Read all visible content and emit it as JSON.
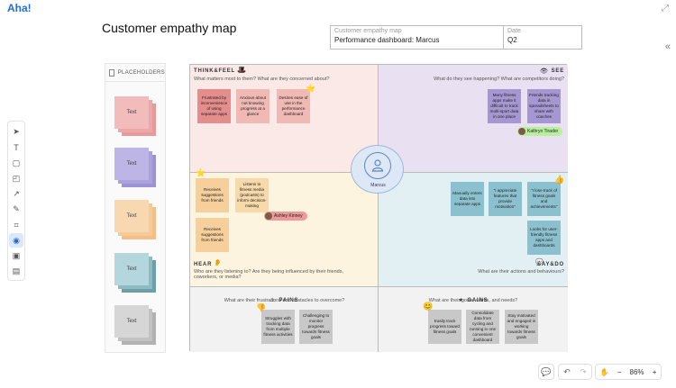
{
  "app": {
    "logo": "Aha!"
  },
  "page": {
    "title": "Customer empathy map"
  },
  "info": {
    "name_label": "Customer empathy map",
    "name_value": "Performance dashboard: Marcus",
    "date_label": "Date",
    "date_value": "Q2"
  },
  "placeholders": {
    "header": "PLACEHOLDERS",
    "items": [
      {
        "label": "Text",
        "color": "#f2b4b4"
      },
      {
        "label": "Text",
        "color": "#b4ade2"
      },
      {
        "label": "Text",
        "color": "#f6d0a5"
      },
      {
        "label": "Text",
        "color": "#a9d2d8"
      },
      {
        "label": "Text",
        "color": "#cfcfcf"
      }
    ]
  },
  "map": {
    "center_name": "Marcus",
    "think": {
      "title": "THINK&FEEL",
      "question": "What matters most to them? What are they concerned about?",
      "notes": [
        "Frustrated by inconvenience of using separate apps",
        "Anxious about not knowing progress at a glance",
        "Desires ease of use in the performance dashboard"
      ]
    },
    "see": {
      "title": "SEE",
      "question": "What do they see happening? What are competitors doing?",
      "notes": [
        "Many fitness apps make it difficult to track multi-sport data in one place",
        "Friends tracking data in spreadsheets to share with coaches"
      ],
      "tag": "Kathryn Tirador"
    },
    "hear": {
      "title": "HEAR",
      "question": "Who are they listening to? Are they being influenced by their friends, coworkers, or media?",
      "notes": [
        "Receives suggestions from friends",
        "Listens to fitness media (podcasts) to inform decision-making",
        "Receives suggestions from friends"
      ],
      "tag": "Ashley Kinney"
    },
    "say": {
      "title": "SAY&DO",
      "question": "What are their actions and behaviours?",
      "notes": [
        "Manually enters data into separate apps",
        "\"I appreciate features that provide motivation\"",
        "\"I lose track of fitness goals and achievements\"",
        "Looks for user-friendly fitness apps and dashboards"
      ]
    },
    "pains": {
      "title": "PAINS",
      "question": "What are their frustrations and obstacles to overcome?",
      "notes": [
        "Struggles with tracking data from multiple fitness activities",
        "Challenging to monitor progress towards fitness goals"
      ]
    },
    "gains": {
      "title": "GAINS",
      "question": "What are their goals, wants, and needs?",
      "notes": [
        "Easily track progress toward fitness goals",
        "Consolidate data from cycling and running in one convenient dashboard",
        "Stay motivated and engaged in working towards fitness goals"
      ]
    }
  },
  "zoom": {
    "level": "86%"
  }
}
